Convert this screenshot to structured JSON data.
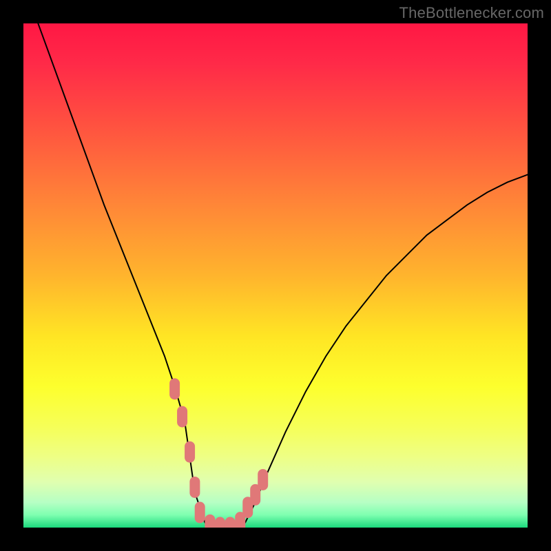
{
  "watermark": "TheBottlenecker.com",
  "colors": {
    "frame": "#000000",
    "watermark": "#676767",
    "curve": "#000000",
    "marker_fill": "#e07878",
    "marker_stroke": "#d86a6a",
    "gradient_stops": [
      {
        "offset": 0.0,
        "color": "#ff1744"
      },
      {
        "offset": 0.08,
        "color": "#ff2a48"
      },
      {
        "offset": 0.2,
        "color": "#ff5140"
      },
      {
        "offset": 0.35,
        "color": "#ff8338"
      },
      {
        "offset": 0.5,
        "color": "#ffb42d"
      },
      {
        "offset": 0.62,
        "color": "#ffe524"
      },
      {
        "offset": 0.72,
        "color": "#fdff2d"
      },
      {
        "offset": 0.8,
        "color": "#f6ff58"
      },
      {
        "offset": 0.86,
        "color": "#eeff85"
      },
      {
        "offset": 0.91,
        "color": "#e0ffb0"
      },
      {
        "offset": 0.95,
        "color": "#b6ffc4"
      },
      {
        "offset": 0.975,
        "color": "#7effb0"
      },
      {
        "offset": 1.0,
        "color": "#1cd97d"
      }
    ]
  },
  "chart_data": {
    "type": "line",
    "title": "",
    "xlabel": "",
    "ylabel": "",
    "xlim": [
      0,
      100
    ],
    "ylim": [
      0,
      100
    ],
    "series": [
      {
        "name": "bottleneck-curve",
        "x": [
          0,
          4,
          8,
          12,
          16,
          20,
          24,
          28,
          30,
          32,
          33,
          34,
          36,
          38,
          40,
          42,
          44,
          46,
          48,
          52,
          56,
          60,
          64,
          68,
          72,
          76,
          80,
          84,
          88,
          92,
          96,
          100
        ],
        "values": [
          108,
          97,
          86,
          75,
          64,
          54,
          44,
          34,
          28,
          21,
          14,
          7,
          1,
          0,
          0,
          0,
          1,
          5,
          10,
          19,
          27,
          34,
          40,
          45,
          50,
          54,
          58,
          61,
          64,
          66.5,
          68.5,
          70
        ]
      }
    ],
    "markers": {
      "name": "highlighted-points",
      "x": [
        30.0,
        31.5,
        33.0,
        34.0,
        35.0,
        37.0,
        39.0,
        41.0,
        43.0,
        44.5,
        46.0,
        47.5
      ],
      "values": [
        27.5,
        22.0,
        15.0,
        8.0,
        3.0,
        0.5,
        0.0,
        0.0,
        1.0,
        4.0,
        6.5,
        9.5
      ]
    }
  }
}
